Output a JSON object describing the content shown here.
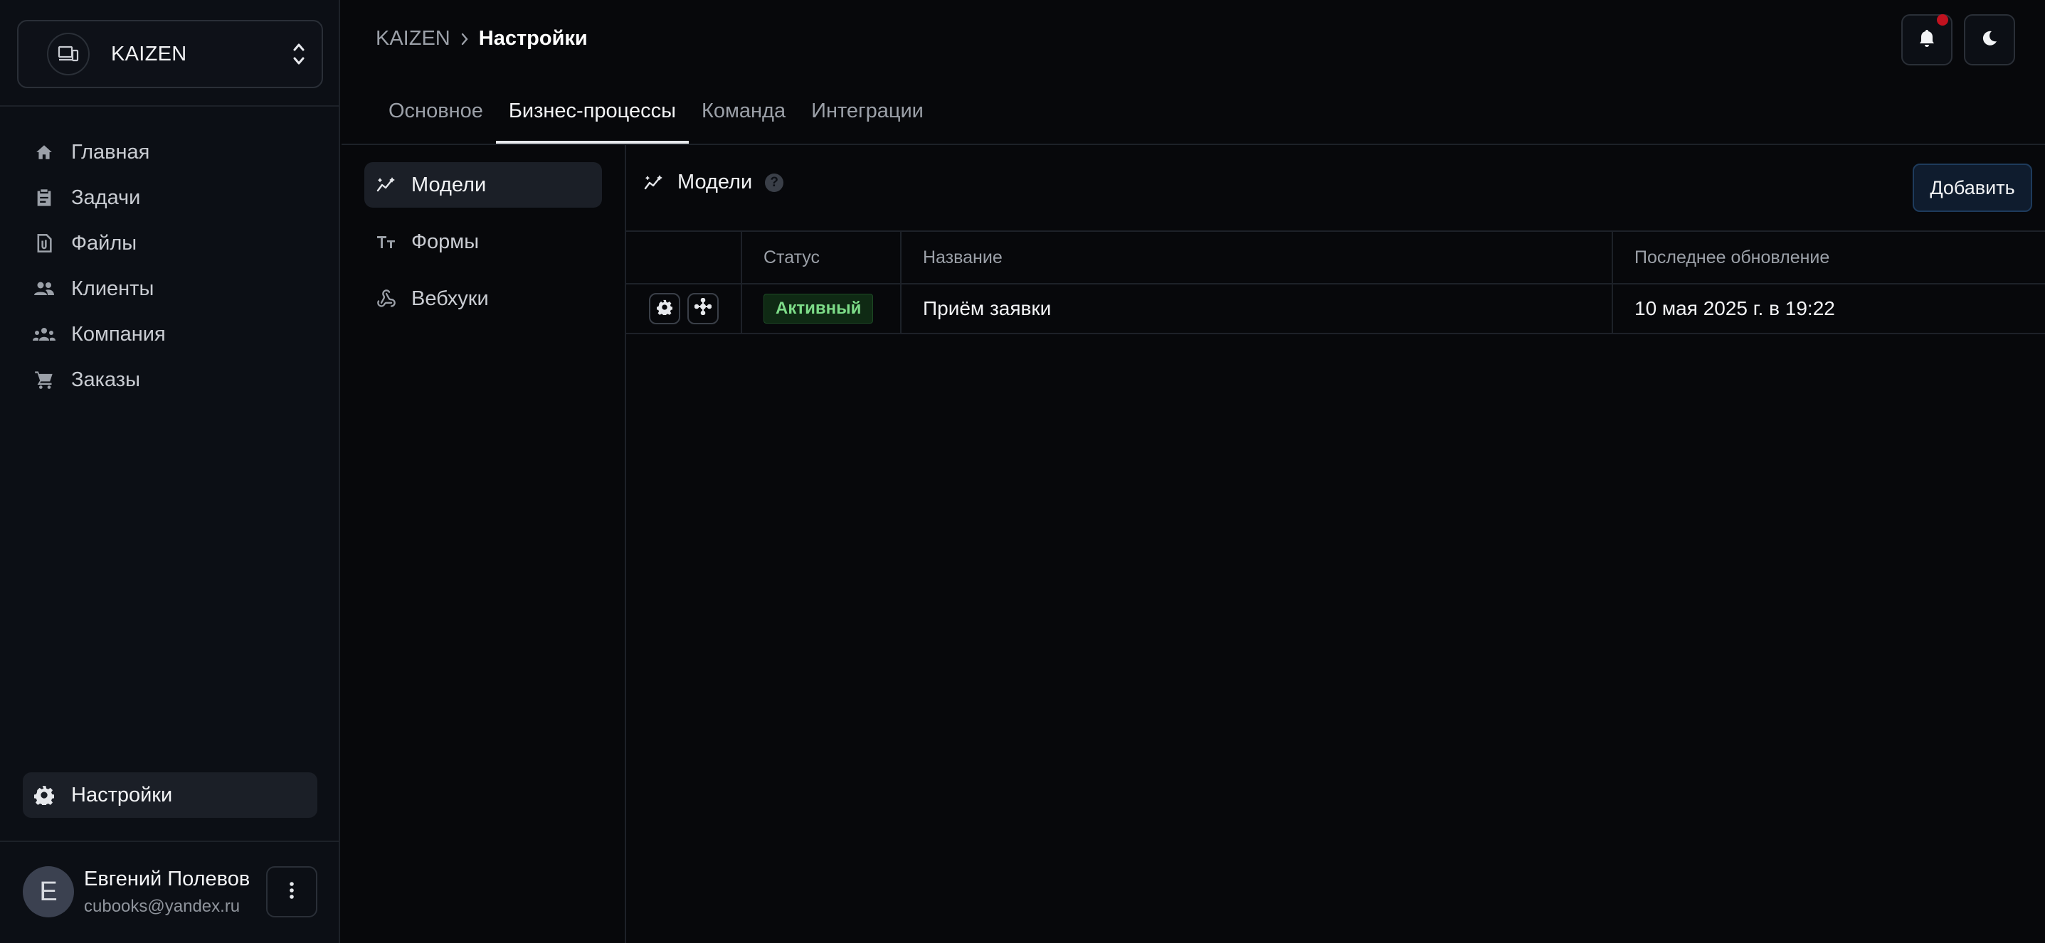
{
  "workspace": {
    "name": "KAIZEN"
  },
  "sidebar": {
    "items": [
      {
        "label": "Главная",
        "icon": "home-icon"
      },
      {
        "label": "Задачи",
        "icon": "clipboard-icon"
      },
      {
        "label": "Файлы",
        "icon": "file-icon"
      },
      {
        "label": "Клиенты",
        "icon": "people-icon"
      },
      {
        "label": "Компания",
        "icon": "groups-icon"
      },
      {
        "label": "Заказы",
        "icon": "cart-icon"
      }
    ],
    "settings_label": "Настройки"
  },
  "user": {
    "initial": "Е",
    "name": "Евгений Полевов",
    "email": "cubooks@yandex.ru"
  },
  "breadcrumb": {
    "root": "KAIZEN",
    "current": "Настройки"
  },
  "tabs": [
    "Основное",
    "Бизнес-процессы",
    "Команда",
    "Интеграции"
  ],
  "active_tab": "Бизнес-процессы",
  "subnav": [
    {
      "label": "Модели",
      "icon": "model-icon"
    },
    {
      "label": "Формы",
      "icon": "text-icon"
    },
    {
      "label": "Вебхуки",
      "icon": "webhook-icon"
    }
  ],
  "content": {
    "title": "Модели",
    "help": "?",
    "add_label": "Добавить",
    "columns": [
      "Статус",
      "Название",
      "Последнее обновление"
    ],
    "rows": [
      {
        "status": "Активный",
        "name": "Приём заявки",
        "updated": "10 мая 2025 г. в 19:22"
      }
    ]
  },
  "colors": {
    "accent": "#1e3b5c",
    "status_active": "#7ddc88",
    "notification_dot": "#c1121f"
  }
}
